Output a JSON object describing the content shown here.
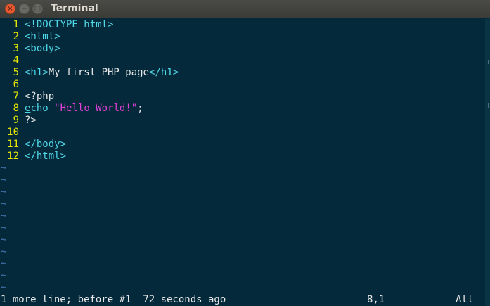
{
  "window": {
    "title": "Terminal",
    "close_glyph": "×",
    "min_glyph": "−",
    "max_glyph": "□"
  },
  "editor": {
    "lines": [
      {
        "num": "1",
        "segments": [
          {
            "t": "<!DOCTYPE html>",
            "c": "tag"
          }
        ]
      },
      {
        "num": "2",
        "segments": [
          {
            "t": "<html>",
            "c": "tag"
          }
        ]
      },
      {
        "num": "3",
        "segments": [
          {
            "t": "<body>",
            "c": "tag"
          }
        ]
      },
      {
        "num": "4",
        "segments": []
      },
      {
        "num": "5",
        "segments": [
          {
            "t": "<h1>",
            "c": "tag"
          },
          {
            "t": "My first PHP page",
            "c": "plain"
          },
          {
            "t": "</h1>",
            "c": "tag"
          }
        ]
      },
      {
        "num": "6",
        "segments": []
      },
      {
        "num": "7",
        "segments": [
          {
            "t": "<?php",
            "c": "plain"
          }
        ]
      },
      {
        "num": "8",
        "segments": [
          {
            "t": "e",
            "c": "tag under"
          },
          {
            "t": "cho",
            "c": "tag"
          },
          {
            "t": " ",
            "c": "plain"
          },
          {
            "t": "\"Hello World!\"",
            "c": "str"
          },
          {
            "t": ";",
            "c": "plain"
          }
        ]
      },
      {
        "num": "9",
        "segments": [
          {
            "t": "?>",
            "c": "plain"
          }
        ]
      },
      {
        "num": "10",
        "segments": []
      },
      {
        "num": "11",
        "segments": [
          {
            "t": "</body>",
            "c": "tag"
          }
        ]
      },
      {
        "num": "12",
        "segments": [
          {
            "t": "</html>",
            "c": "tag"
          }
        ]
      }
    ],
    "filler_glyph": "~",
    "filler_count": 11
  },
  "status": {
    "message": "1 more line; before #1  72 seconds ago",
    "position": "8,1",
    "scroll": "All"
  },
  "colors": {
    "background": "#04293a",
    "line_number": "#e8e800",
    "tag": "#4ed8e8",
    "string": "#e040d8",
    "tilde": "#4b78b8"
  }
}
